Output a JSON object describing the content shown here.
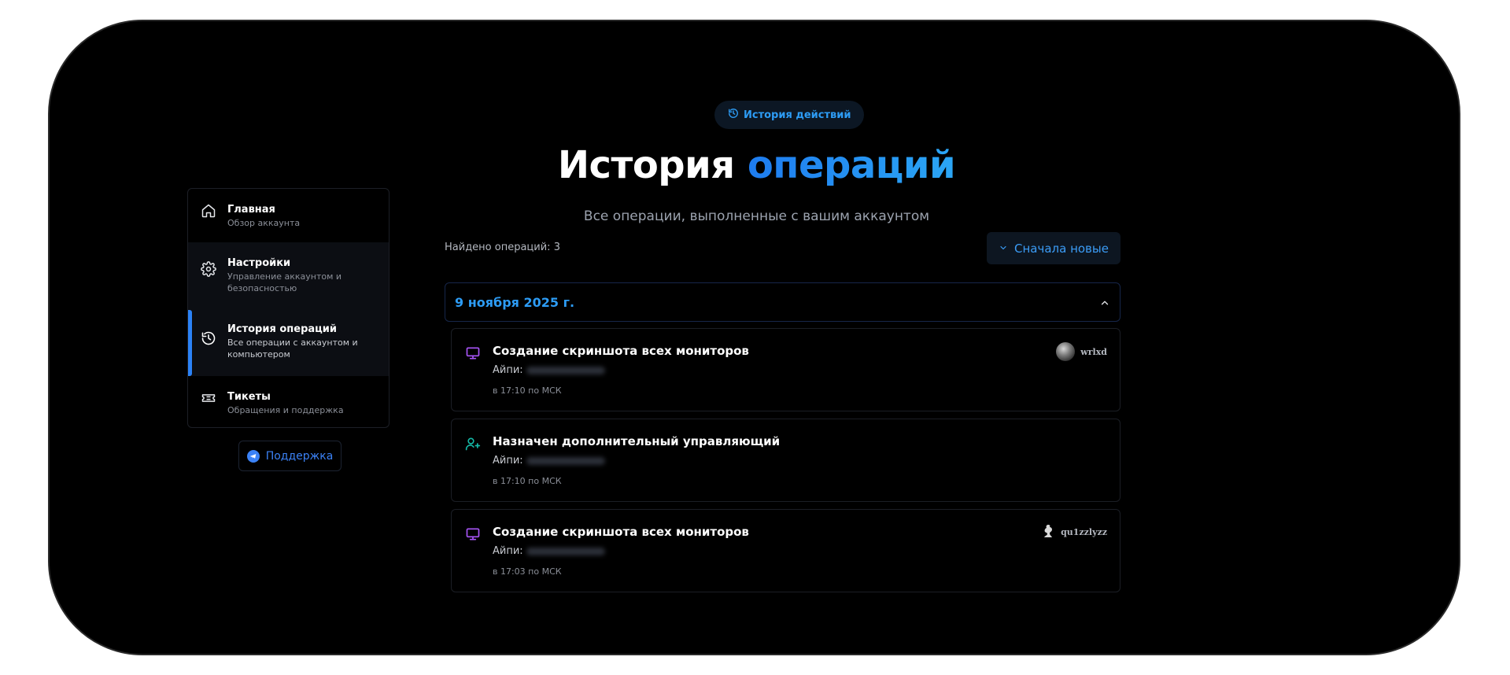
{
  "header": {
    "badge_label": "История действий",
    "title_main": "История",
    "title_accent": "операций",
    "subtitle": "Все операции, выполненные с вашим аккаунтом"
  },
  "sidebar": {
    "items": [
      {
        "label": "Главная",
        "sub": "Обзор аккаунта",
        "icon": "home-icon",
        "active": false
      },
      {
        "label": "Настройки",
        "sub": "Управление аккаунтом и безопасностью",
        "icon": "gear-icon",
        "active": false
      },
      {
        "label": "История операций",
        "sub": "Все операции с аккаунтом и компьютером",
        "icon": "history-icon",
        "active": true
      },
      {
        "label": "Тикеты",
        "sub": "Обращения и поддержка",
        "icon": "ticket-icon",
        "active": false
      }
    ],
    "support_label": "Поддержка"
  },
  "main": {
    "found_label": "Найдено операций: 3",
    "sort_label": "Сначала новые",
    "groups": [
      {
        "date": "9 ноября 2025 г.",
        "operations": [
          {
            "title": "Создание скриншота всех мониторов",
            "ip_label": "Айпи:",
            "time": "в 17:10 по МСК",
            "user": "wrlxd",
            "icon": "monitor-icon"
          },
          {
            "title": "Назначен дополнительный управляющий",
            "ip_label": "Айпи:",
            "time": "в 17:10 по МСК",
            "user": "",
            "icon": "user-plus-icon"
          },
          {
            "title": "Создание скриншота всех мониторов",
            "ip_label": "Айпи:",
            "time": "в 17:03 по МСК",
            "user": "qu1zzlyzz",
            "icon": "monitor-icon"
          }
        ]
      }
    ]
  },
  "colors": {
    "accent": "#2d9cf5",
    "active_bar": "#2b82f6",
    "monitor_icon": "#a855f7",
    "user_icon": "#14b8a6",
    "background": "#000000"
  }
}
